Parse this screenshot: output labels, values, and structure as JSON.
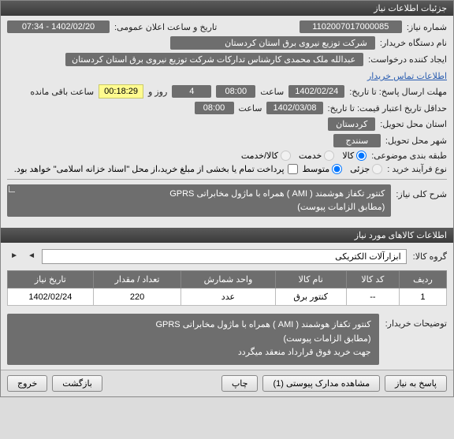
{
  "titlebar": "جزئیات اطلاعات نیاز",
  "fields": {
    "need_no_label": "شماره نیاز:",
    "need_no": "1102007017000085",
    "announce_label": "تاریخ و ساعت اعلان عمومی:",
    "announce_val": "1402/02/20 - 07:34",
    "buyer_label": "نام دستگاه خریدار:",
    "buyer_val": "شرکت توزیع نیروی برق استان کردستان",
    "creator_label": "ایجاد کننده درخواست:",
    "creator_val": "عبدالله ملک محمدی کارشناس تدارکات شرکت توزیع نیروی برق استان کردستان",
    "contact_link": "اطلاعات تماس خریدار",
    "deadline_label": "مهلت ارسال پاسخ: تا تاریخ:",
    "deadline_date": "1402/02/24",
    "saat": "ساعت",
    "deadline_time": "08:00",
    "days_label": "روز و",
    "days_val": "4",
    "timer": "00:18:29",
    "remain": "ساعت باقی مانده",
    "valid_label": "حداقل تاریخ اعتبار قیمت: تا تاریخ:",
    "valid_date": "1402/03/08",
    "valid_time": "08:00",
    "province_label": "استان محل تحویل:",
    "province_val": "کردستان",
    "city_label": "شهر محل تحویل:",
    "city_val": "سنندج",
    "category_label": "طبقه بندی موضوعی:",
    "cat_goods": "کالا",
    "cat_service": "خدمت",
    "cat_both": "کالا/خدمت",
    "process_label": "نوع فرآیند خرید :",
    "proc_minor": "جزئی",
    "proc_medium": "متوسط",
    "pay_note": "پرداخت تمام یا بخشی از مبلغ خرید،از محل \"اسناد خزانه اسلامی\" خواهد بود.",
    "summary_label": "شرح کلی نیاز:",
    "summary_l1": "کنتور تکفاز هوشمند ( AMI ) همراه با ماژول مخابراتی GPRS",
    "summary_l2": "(مطابق الزامات پیوست)"
  },
  "section2": "اطلاعات کالاهای مورد نیاز",
  "group": {
    "label": "گروه کالا:",
    "value": "ابزارآلات الکتریکی"
  },
  "table": {
    "headers": [
      "ردیف",
      "کد کالا",
      "نام کالا",
      "واحد شمارش",
      "تعداد / مقدار",
      "تاریخ نیاز"
    ],
    "rows": [
      {
        "cells": [
          "1",
          "--",
          "کنتور برق",
          "عدد",
          "220",
          "1402/02/24"
        ]
      }
    ]
  },
  "buyer_desc": {
    "label": "توضیحات خریدار:",
    "l1": "کنتور تکفاز هوشمند ( AMI ) همراه با ماژول مخابراتی GPRS",
    "l2": "(مطابق الزامات پیوست)",
    "l3": "جهت خرید فوق قرارداد منعقد میگردد"
  },
  "footer": {
    "reply": "پاسخ به نیاز",
    "attach": "مشاهده مدارک پیوستی (1)",
    "print": "چاپ",
    "back": "بازگشت",
    "exit": "خروج"
  }
}
